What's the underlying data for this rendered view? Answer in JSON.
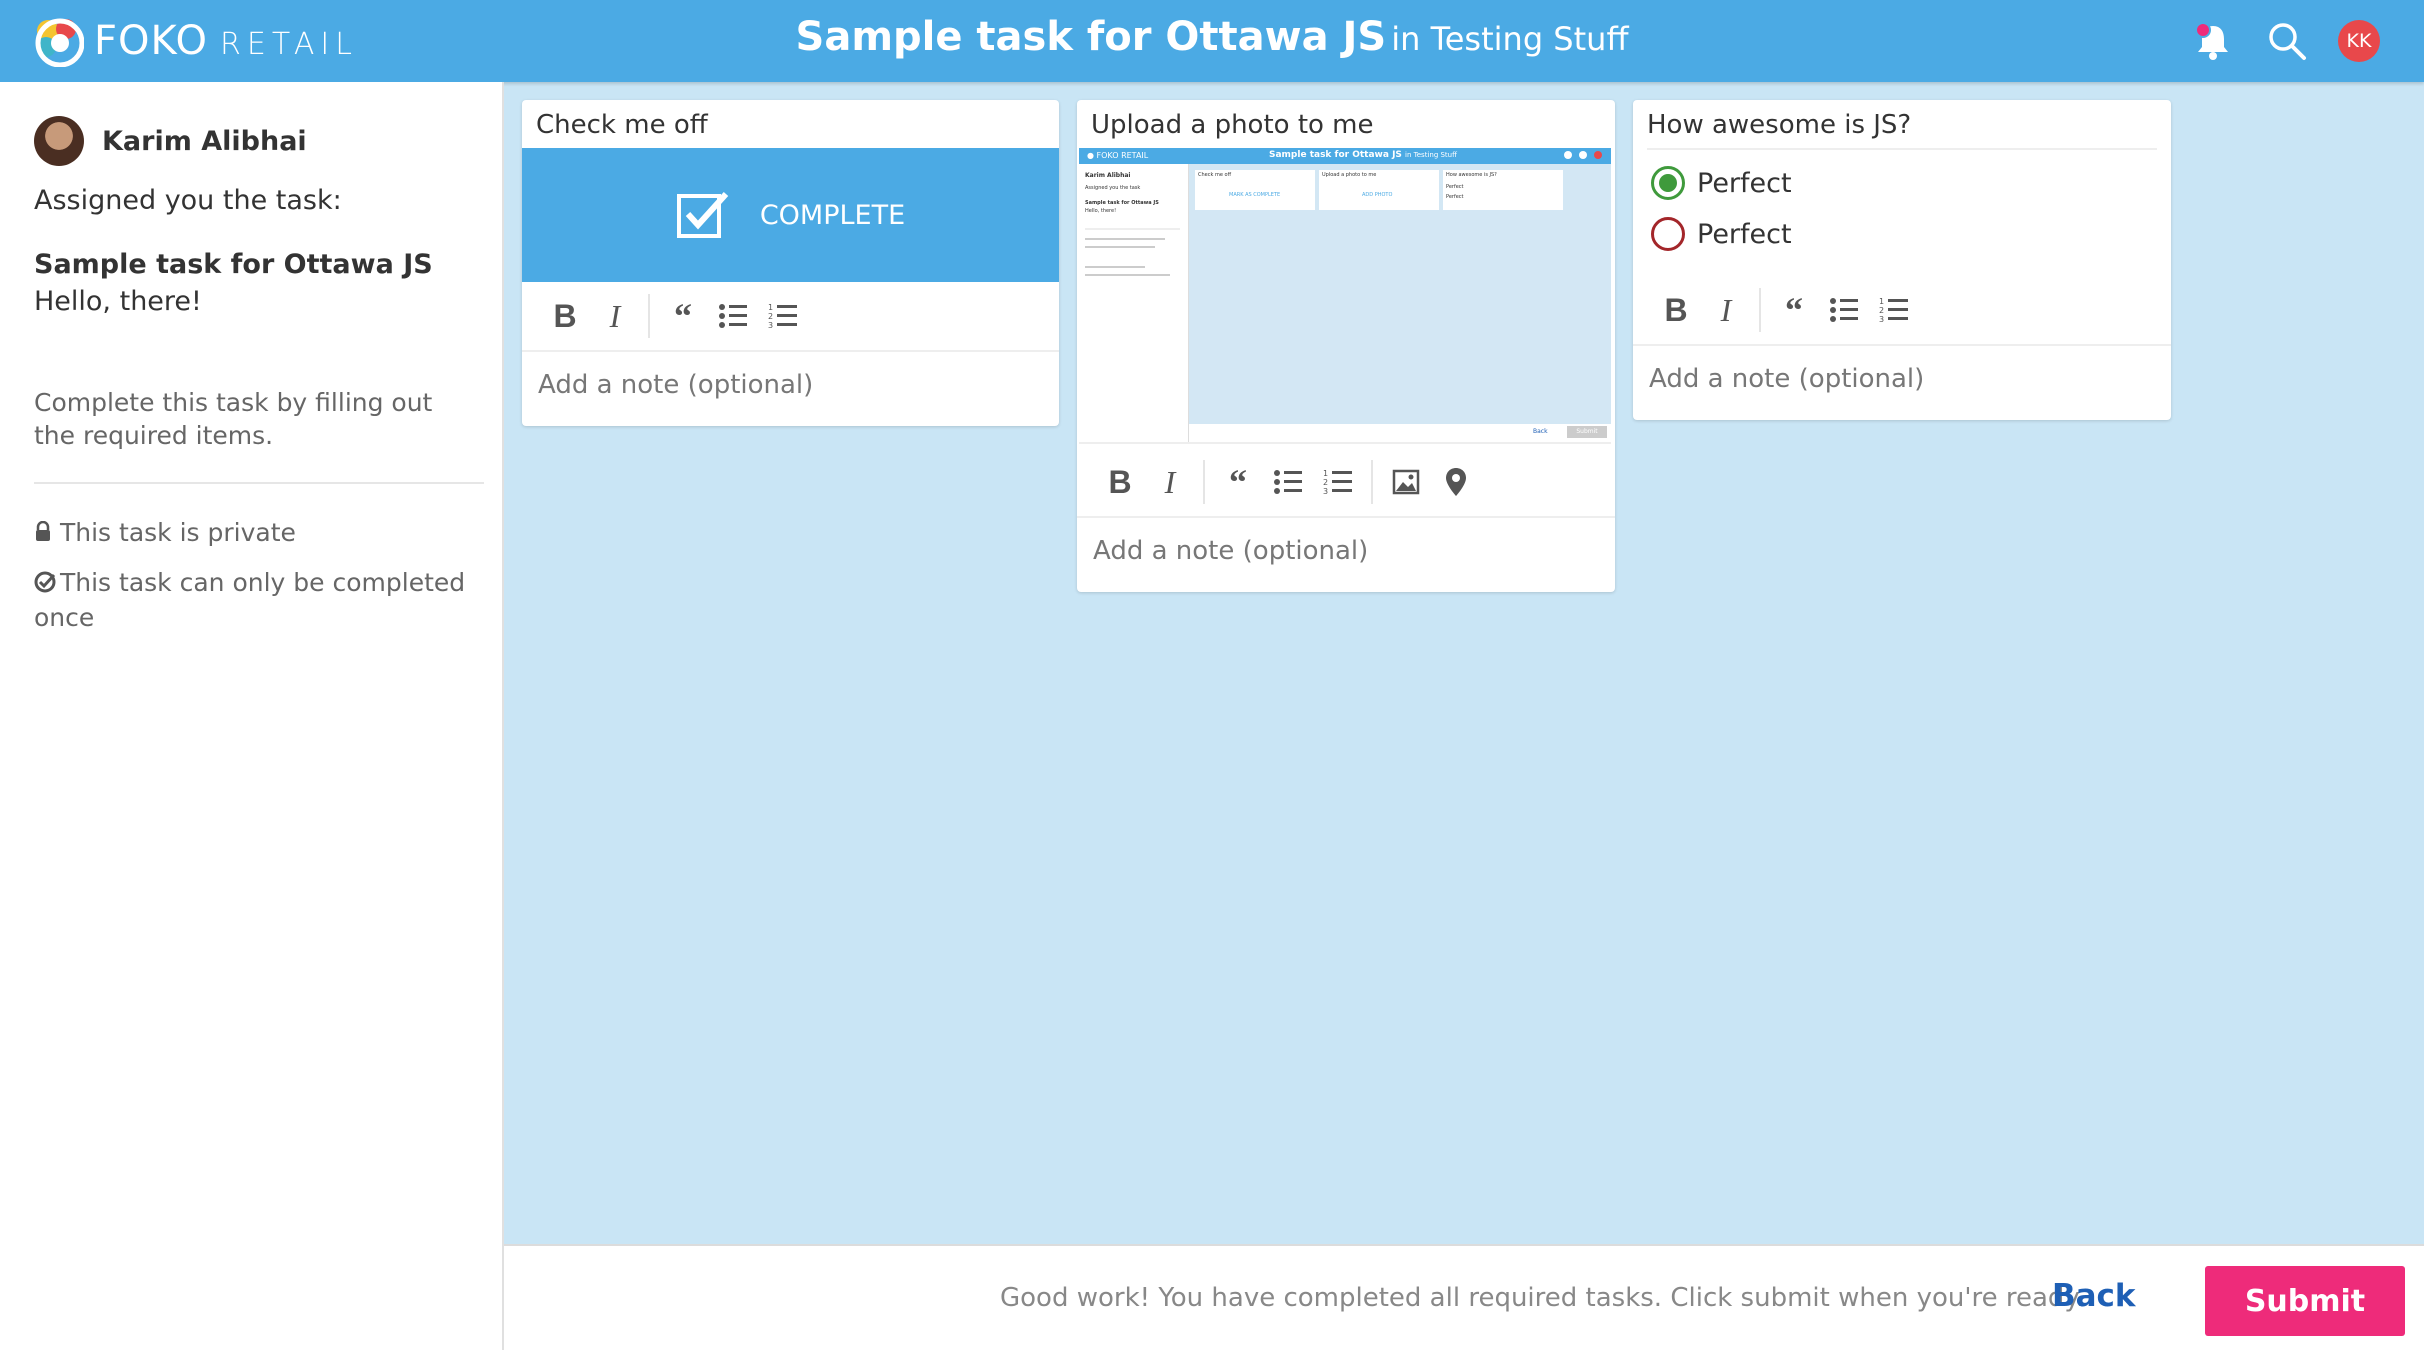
{
  "header": {
    "logo_brand": "FOKO",
    "logo_suffix": "RETAIL",
    "title_main": "Sample task for Ottawa JS",
    "title_sub": "in Testing Stuff",
    "icons": [
      "notifications-bell-icon",
      "search-icon"
    ],
    "user_initials": "KK",
    "accent": "#4baae4"
  },
  "sidebar": {
    "user_name": "Karim Alibhai",
    "assigned_text": "Assigned you the task:",
    "task_name": "Sample task for Ottawa JS",
    "task_description": "Hello, there!",
    "instructions": "Complete this task by filling out the required items.",
    "private_text": "This task is private",
    "once_text": "This task can only be completed once"
  },
  "cards": {
    "check": {
      "title": "Check me off",
      "button_label": "COMPLETE",
      "note_placeholder": "Add a note (optional)"
    },
    "photo": {
      "title": "Upload a photo to me",
      "note_placeholder": "Add a note (optional)"
    },
    "poll": {
      "title": "How awesome is JS?",
      "options": [
        {
          "label": "Perfect",
          "selected": true
        },
        {
          "label": "Perfect",
          "selected": false
        }
      ],
      "note_placeholder": "Add a note (optional)"
    }
  },
  "thumbnail": {
    "header_title": "Sample task for Ottawa JS",
    "header_sub": "in Testing Stuff",
    "user_name": "Karim Alibhai",
    "assigned": "Assigned you the task",
    "task_name": "Sample task for Ottawa JS",
    "task_desc": "Hello, there!",
    "card1_title": "Check me off",
    "card1_btn": "MARK AS COMPLETE",
    "card2_title": "Upload a photo to me",
    "card2_btn": "ADD PHOTO",
    "card3_title": "How awesome is JS?",
    "opt1": "Perfect",
    "opt2": "Perfect",
    "back": "Back",
    "submit": "Submit"
  },
  "footer": {
    "message": "Good work! You have completed all required tasks. Click submit when you're ready.",
    "back_label": "Back",
    "submit_label": "Submit",
    "submit_color": "#ee2b7a",
    "back_color": "#1e5fb5"
  }
}
